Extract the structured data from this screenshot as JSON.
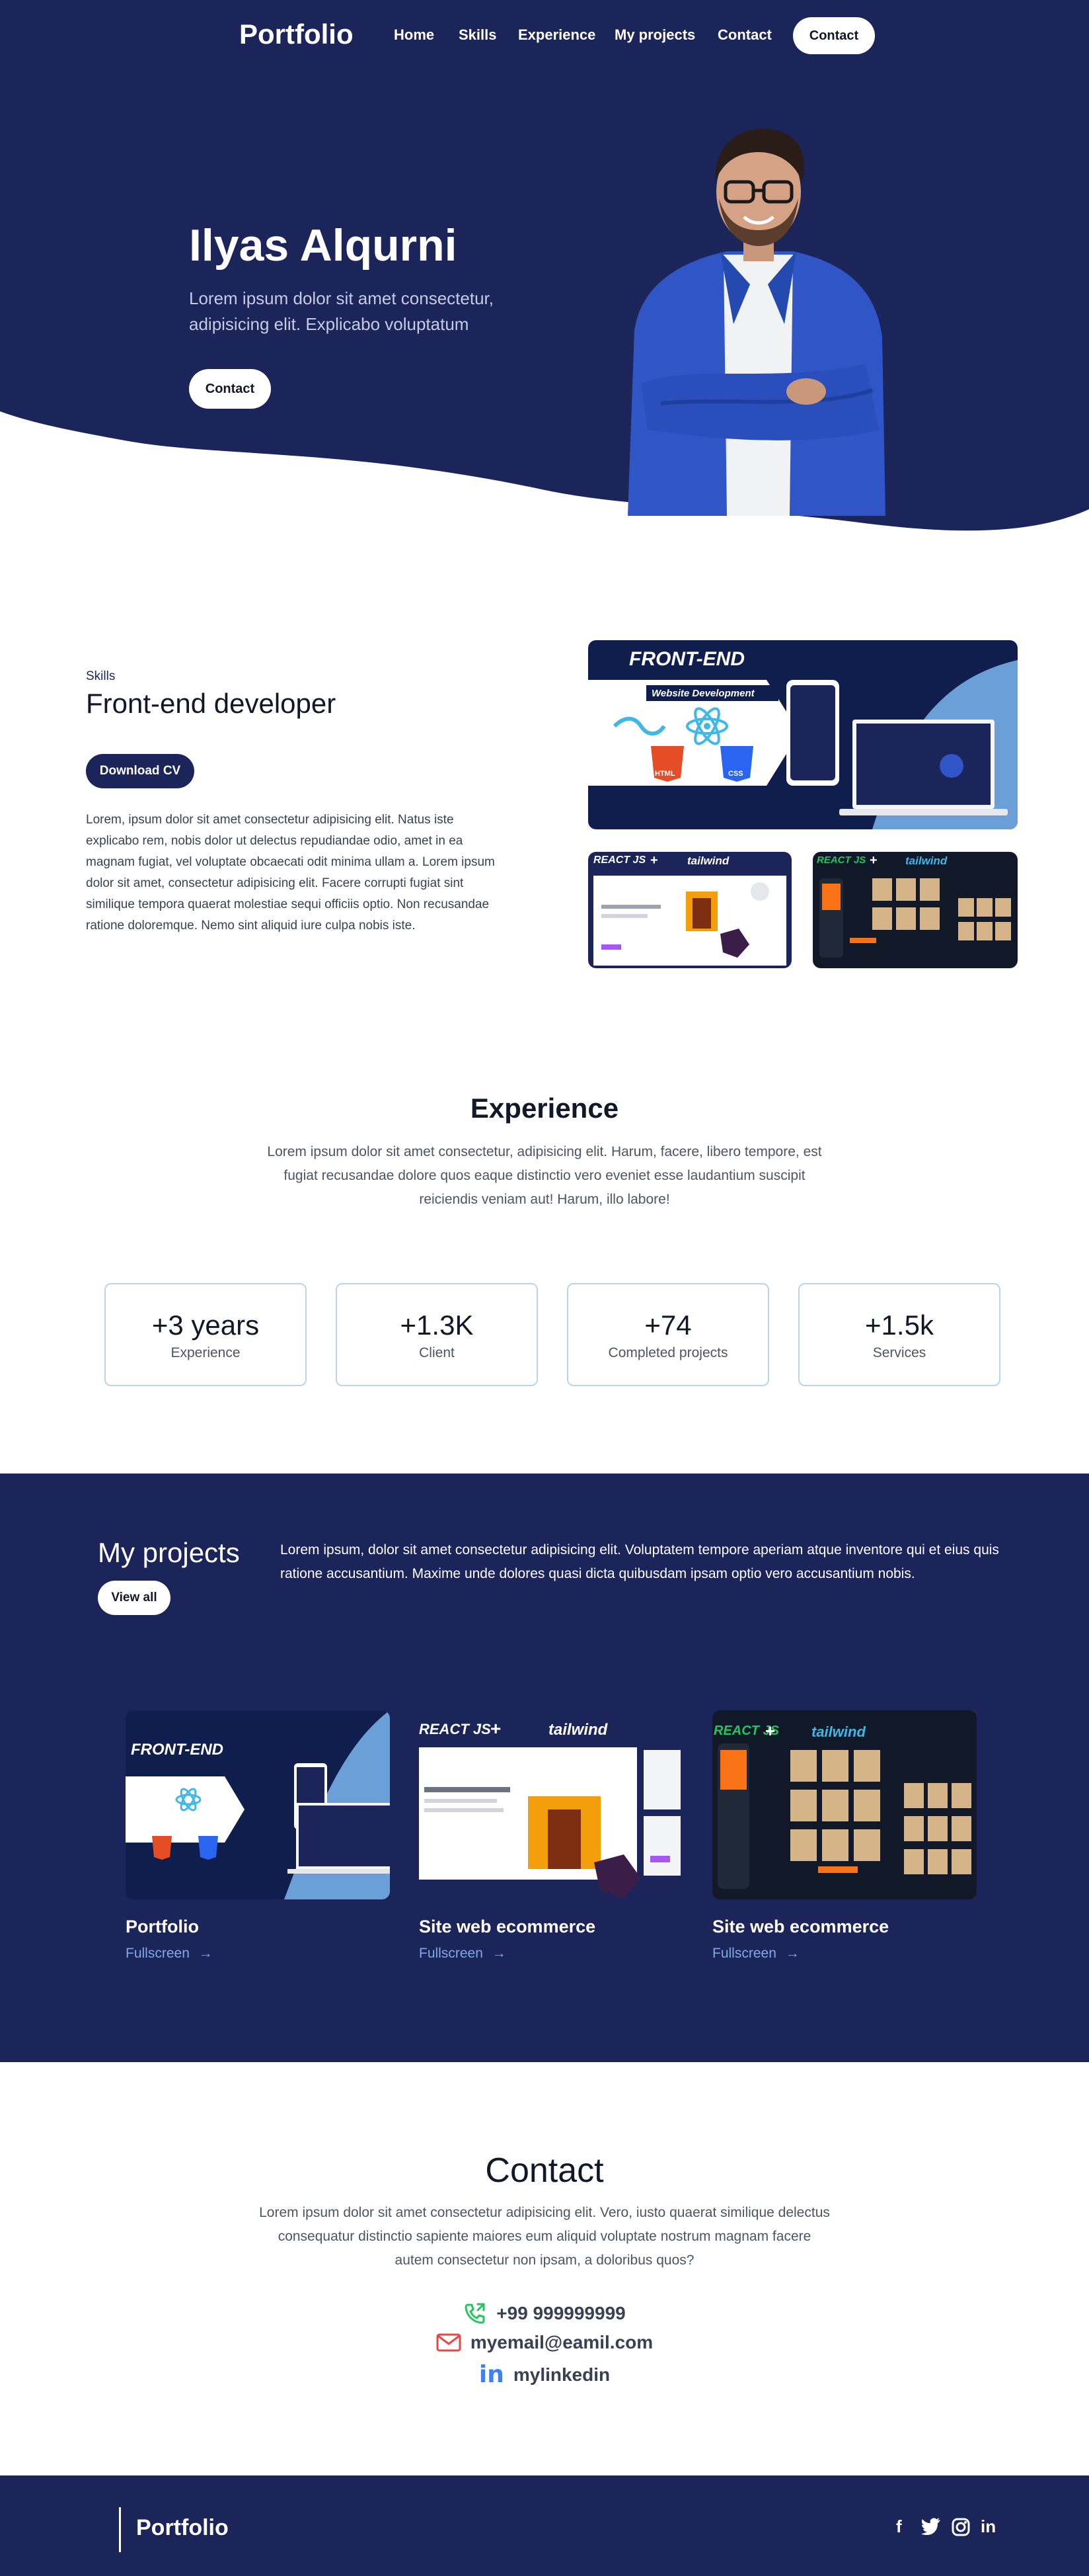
{
  "nav": {
    "logo": "Portfolio",
    "links": [
      "Home",
      "Skills",
      "Experience",
      "My projects",
      "Contact"
    ],
    "cta": "Contact"
  },
  "hero": {
    "name": "Ilyas Alqurni",
    "subtitle": "Lorem ipsum dolor sit amet consectetur, adipisicing elit. Explicabo voluptatum",
    "cta": "Contact"
  },
  "skills": {
    "tag": "Skills",
    "title": "Front-end developer",
    "button": "Download CV",
    "body": "Lorem, ipsum dolor sit amet consectetur adipisicing elit. Natus iste explicabo rem, nobis dolor ut delectus repudiandae odio, amet in ea magnam fugiat, vel voluptate obcaecati odit minima ullam a. Lorem ipsum dolor sit amet, consectetur adipisicing elit. Facere corrupti fugiat sint similique tempora quaerat molestiae sequi officiis optio. Non recusandae ratione doloremque. Nemo sint aliquid iure culpa nobis iste.",
    "images": {
      "main_title": "FRONT-END",
      "main_subtitle": "Website Development",
      "react_label": "REACT JS",
      "tailwind_label": "tailwind",
      "html_label": "HTML",
      "css_label": "CSS",
      "plus": "+"
    }
  },
  "experience": {
    "title": "Experience",
    "body": "Lorem ipsum dolor sit amet consectetur, adipisicing elit. Harum, facere, libero tempore, est fugiat recusandae dolore quos eaque distinctio vero eveniet esse laudantium suscipit reiciendis veniam aut! Harum, illo labore!",
    "stats": [
      {
        "value": "+3 years",
        "label": "Experience"
      },
      {
        "value": "+1.3K",
        "label": "Client"
      },
      {
        "value": "+74",
        "label": "Completed projects"
      },
      {
        "value": "+1.5k",
        "label": "Services"
      }
    ]
  },
  "projects": {
    "title": "My projects",
    "view_all": "View all",
    "description": "Lorem ipsum, dolor sit amet consectetur adipisicing elit. Voluptatem tempore aperiam atque inventore qui et eius quis ratione accusantium. Maxime unde dolores quasi dicta quibusdam ipsam optio vero accusantium nobis.",
    "items": [
      {
        "name": "Portfolio",
        "link": "Fullscreen",
        "arrow": "→"
      },
      {
        "name": "Site web ecommerce",
        "link": "Fullscreen",
        "arrow": "→"
      },
      {
        "name": "Site web ecommerce",
        "link": "Fullscreen",
        "arrow": "→"
      }
    ]
  },
  "contact": {
    "title": "Contact",
    "body": "Lorem ipsum dolor sit amet consectetur adipisicing elit. Vero, iusto quaerat similique delectus consequatur distinctio sapiente maiores eum aliquid voluptate nostrum magnam facere autem consectetur non ipsam, a doloribus quos?",
    "phone": "+99 999999999",
    "email": "myemail@eamil.com",
    "linkedin": "mylinkedin",
    "icon_labels": {
      "linkedin": "in"
    }
  },
  "footer": {
    "logo": "Portfolio",
    "socials": [
      "f",
      "in"
    ]
  },
  "colors": {
    "navy": "#1b2559",
    "light_blue": "#6b9fd8",
    "accent_green": "#22c55e",
    "accent_red": "#ef4444",
    "linkedin_blue": "#3b82f6"
  },
  "icons": [
    "facebook-icon",
    "twitter-icon",
    "instagram-icon",
    "linkedin-icon",
    "phone-icon",
    "mail-icon",
    "arrow-right-icon"
  ]
}
